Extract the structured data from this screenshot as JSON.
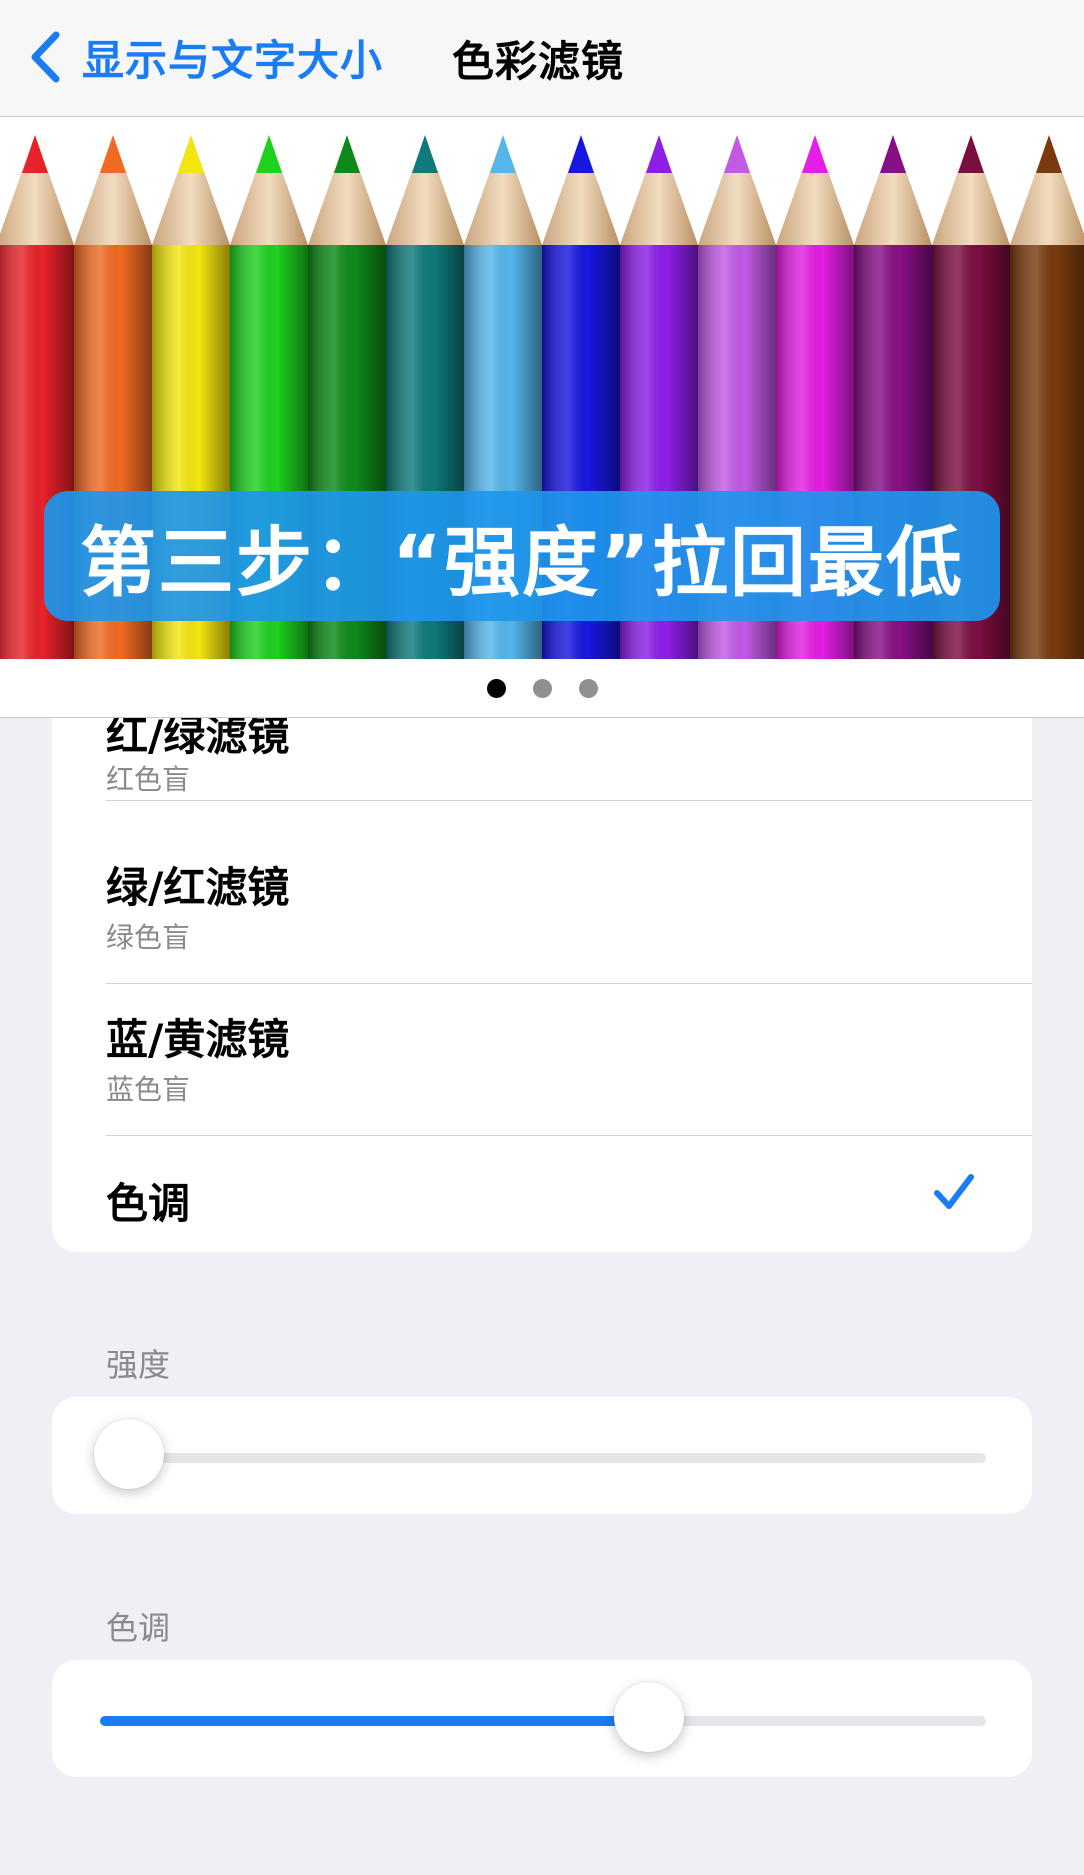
{
  "nav": {
    "back_label": "显示与文字大小",
    "title": "色彩滤镜",
    "back_icon": "chevron-left-icon",
    "accent_color": "#1a7cf5"
  },
  "carousel": {
    "caption": "第三步：“强度”拉回最低",
    "pencil_colors": [
      "#e8222a",
      "#f06a22",
      "#f3e60e",
      "#1ed11e",
      "#0e8a1a",
      "#0f7a7a",
      "#55b6ea",
      "#1717e0",
      "#8c1ee8",
      "#c25ae6",
      "#e41ee4",
      "#860f86",
      "#7a0e40",
      "#7a3a0e"
    ],
    "page_count": 3,
    "active_page": 1
  },
  "filters": {
    "items": [
      {
        "title": "红/绿滤镜",
        "subtitle": "红色盲",
        "selected": false
      },
      {
        "title": "绿/红滤镜",
        "subtitle": "绿色盲",
        "selected": false
      },
      {
        "title": "蓝/黄滤镜",
        "subtitle": "蓝色盲",
        "selected": false
      },
      {
        "title": "色调",
        "subtitle": "",
        "selected": true
      }
    ],
    "check_icon": "checkmark-icon"
  },
  "intensity": {
    "label": "强度",
    "value": 0.0
  },
  "hue": {
    "label": "色调",
    "value": 0.62
  }
}
